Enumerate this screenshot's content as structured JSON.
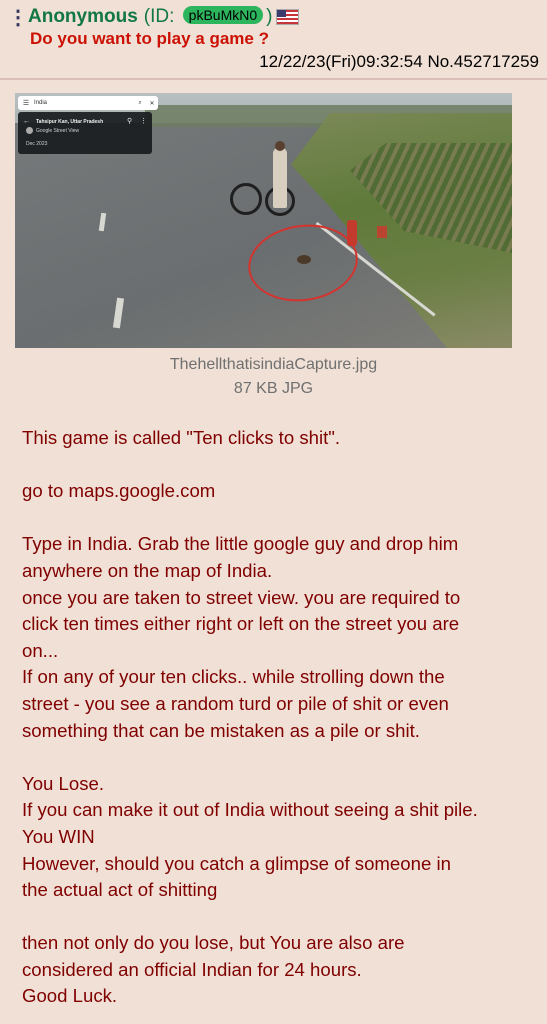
{
  "post": {
    "menu_icon": "vertical-dots",
    "name": "Anonymous",
    "id_prefix": "(ID:",
    "poster_id": "pkBuMkN0",
    "id_suffix": ")",
    "flag": "US flag",
    "subject": "Do you want to play a game ?",
    "datetime": "12/22/23(Fri)09:32:54",
    "post_number": "No.452717259"
  },
  "attachment": {
    "filename": "ThehellthatisindiaCapture.jpg",
    "filesize": "87 KB JPG",
    "screenshot": {
      "search_text": "India",
      "location_title": "Tahsipur Kan, Uttar Pradesh",
      "source": "Google Street View",
      "date": "Dec 2023"
    }
  },
  "body_lines": [
    "This game is called \"Ten clicks to shit\".",
    "",
    "go to maps.google.com",
    "",
    "Type in India. Grab the little google guy and drop him",
    "anywhere on the map of India.",
    "once you are taken to street view. you are required to",
    "click ten times either right or left on the street you are",
    "on...",
    "If on any of your ten clicks.. while strolling down the",
    "street - you see a random turd or pile of shit or even",
    "something that can be mistaken as a pile or shit.",
    "",
    "You Lose.",
    "If you can make it out of India without seeing a shit pile.",
    "You WIN",
    "However, should you catch a glimpse of someone in",
    "the actual act of shitting",
    "",
    "then not only do you lose, but You are also are",
    "considered an official Indian for 24 hours.",
    "Good Luck."
  ],
  "colors": {
    "background": "#f0e0d6",
    "name": "#117743",
    "subject": "#cc1105",
    "body_text": "#800000",
    "id_badge": "#2db55d",
    "circle": "#d5332e"
  }
}
